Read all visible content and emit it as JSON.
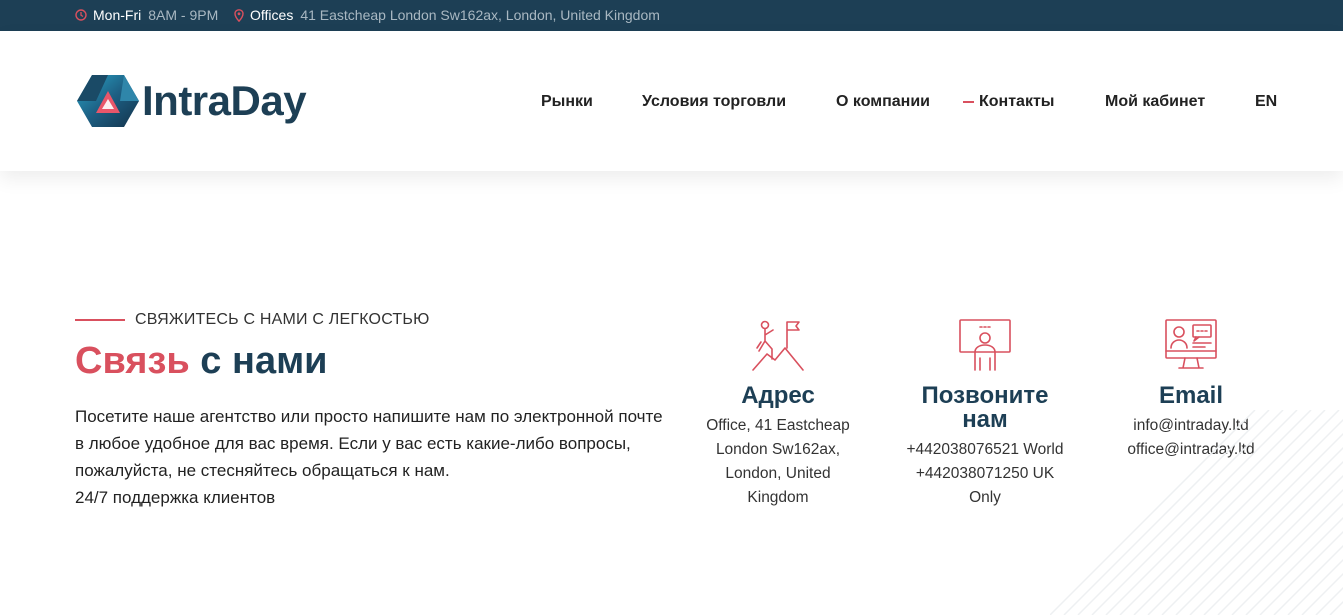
{
  "topbar": {
    "hours_label": "Mon-Fri",
    "hours_value": "8AM - 9PM",
    "office_label": "Offices",
    "office_value": "41 Eastcheap London Sw162ax, London, United Kingdom"
  },
  "logo": {
    "text": "IntraDay"
  },
  "nav": {
    "items": [
      "Рынки",
      "Условия торговли",
      "О компании",
      "Контакты",
      "Мой кабинет",
      "EN"
    ]
  },
  "contact": {
    "eyebrow": "СВЯЖИТЕСЬ С НАМИ С ЛЕГКОСТЬЮ",
    "title_part1": "Связь",
    "title_part2": "с нами",
    "intro": "Посетите наше агентство или просто напишите нам по электронной почте в любое удобное для вас время. Если у вас есть какие-либо вопросы, пожалуйста, не стесняйтесь обращаться к нам.",
    "support": "24/7 поддержка клиентов"
  },
  "cards": [
    {
      "title": "Адрес",
      "lines": [
        "Office, 41 Eastcheap",
        "London Sw162ax,",
        "London, United",
        "Kingdom"
      ],
      "icon": "climber-flag-icon"
    },
    {
      "title_line1": "Позвоните",
      "title_line2": "нам",
      "lines": [
        "+442038076521 World",
        "+442038071250 UK",
        "Only"
      ],
      "icon": "presentation-person-icon"
    },
    {
      "title": "Email",
      "lines": [
        "info@intraday.ltd",
        "office@intraday.ltd"
      ],
      "icon": "monitor-chat-icon"
    }
  ],
  "colors": {
    "accent": "#d9505e",
    "brand": "#1d3f55",
    "topbar": "#1d3f55"
  }
}
